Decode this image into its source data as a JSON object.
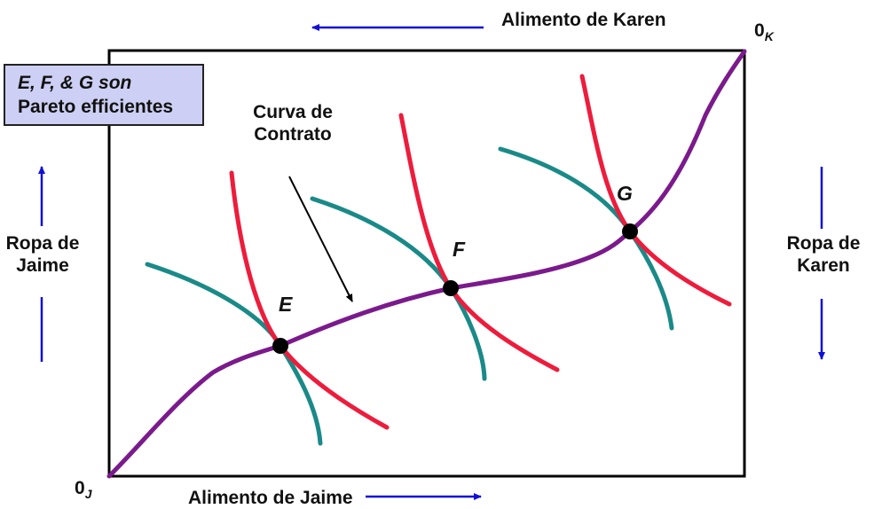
{
  "labels": {
    "karen_food": "Alimento de Karen",
    "jaime_food": "Alimento de Jaime",
    "jaime_clothing_line1": "Ropa de",
    "jaime_clothing_line2": "Jaime",
    "karen_clothing_line1": "Ropa de",
    "karen_clothing_line2": "Karen",
    "contract_curve_line1": "Curva de",
    "contract_curve_line2": "Contrato",
    "origin_jaime": "0",
    "origin_jaime_sub": "J",
    "origin_karen": "0",
    "origin_karen_sub": "K"
  },
  "note": {
    "line1": "E, F, & G son",
    "line2": "Pareto efficientes"
  },
  "points": [
    {
      "name": "E"
    },
    {
      "name": "F"
    },
    {
      "name": "G"
    }
  ],
  "colors": {
    "contract_curve": "#7b1a8c",
    "jaime_indifference": "#1a8a88",
    "karen_indifference": "#ee1c3c",
    "arrows": "#1010d8",
    "box_fill": "#cdd0f4"
  }
}
